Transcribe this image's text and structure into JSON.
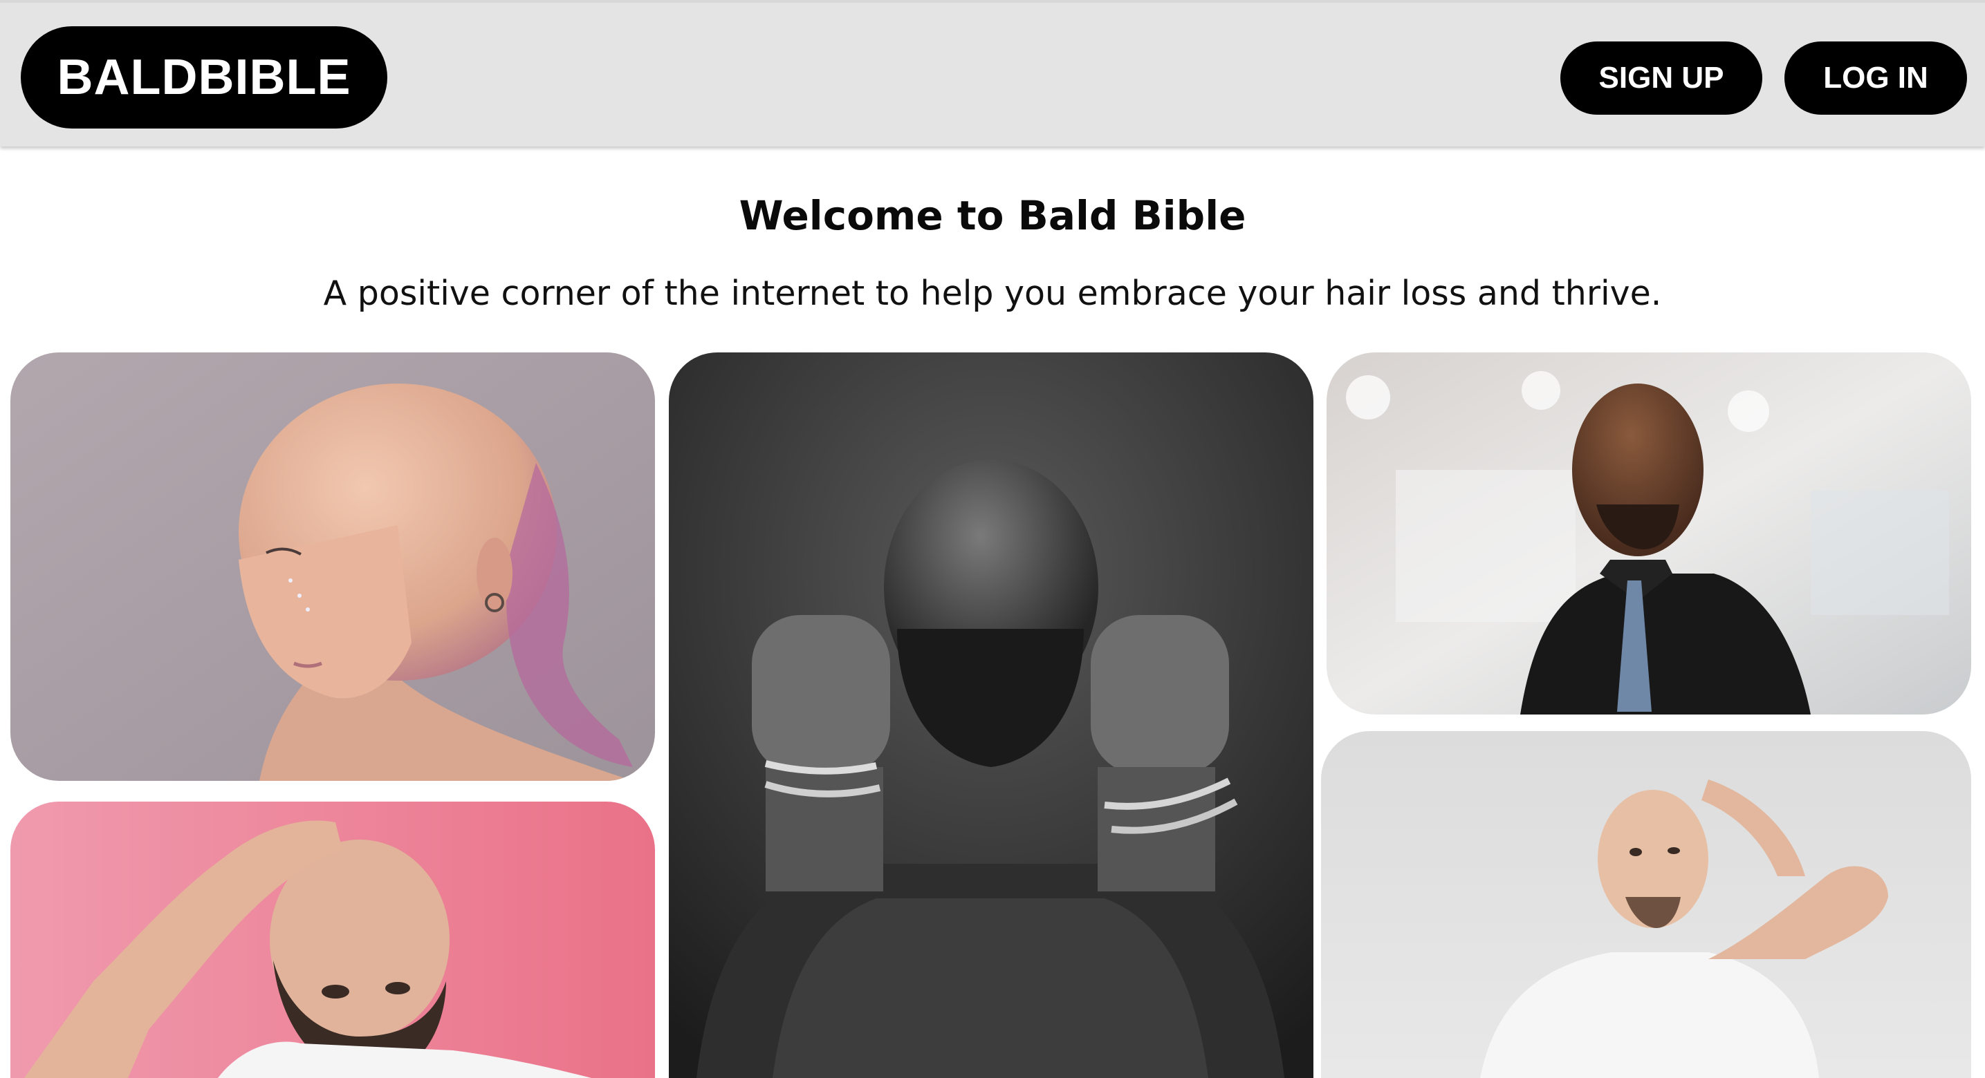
{
  "header": {
    "logo_text": "BALDBIBLE",
    "signup_label": "SIGN UP",
    "login_label": "LOG IN"
  },
  "hero": {
    "title": "Welcome to Bald Bible",
    "subtitle": "A positive corner of the internet to help you embrace your hair loss and thrive."
  },
  "colors": {
    "header_bg": "#e4e4e4",
    "button_bg": "#000000",
    "button_text": "#ffffff",
    "page_bg": "#ffffff"
  }
}
